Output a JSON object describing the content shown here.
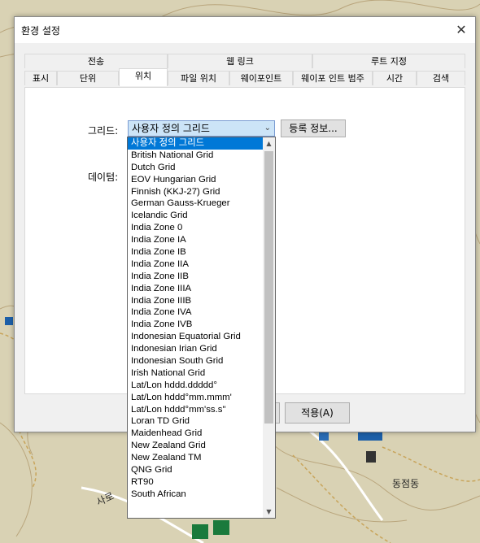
{
  "dialog": {
    "title": "환경 설정",
    "close_label": "✕"
  },
  "tab_groups": [
    {
      "label": "전송"
    },
    {
      "label": "웹 링크"
    },
    {
      "label": "루트 지정"
    }
  ],
  "tabs": [
    {
      "label": "표시"
    },
    {
      "label": "단위"
    },
    {
      "label": "위치",
      "active": true
    },
    {
      "label": "파일 위치"
    },
    {
      "label": "웨이포인트"
    },
    {
      "label": "웨이포 인트 범주"
    },
    {
      "label": "시간"
    },
    {
      "label": "검색"
    }
  ],
  "position_panel": {
    "grid_label": "그리드:",
    "datum_label": "데이텀:",
    "grid_value": "사용자 정의 그리드",
    "register_button": "등록 정보...",
    "apply_button": "적용(A)"
  },
  "grid_options": [
    "사용자 정의 그리드",
    "British National Grid",
    "Dutch Grid",
    "EOV Hungarian Grid",
    "Finnish (KKJ-27) Grid",
    "German Gauss-Krueger",
    "Icelandic Grid",
    "India Zone 0",
    "India Zone IA",
    "India Zone IB",
    "India Zone IIA",
    "India Zone IIB",
    "India Zone IIIA",
    "India Zone IIIB",
    "India Zone IVA",
    "India Zone IVB",
    "Indonesian Equatorial Grid",
    "Indonesian Irian Grid",
    "Indonesian South Grid",
    "Irish National Grid",
    "Lat/Lon hddd.ddddd°",
    "Lat/Lon hddd°mm.mmm'",
    "Lat/Lon hddd°mm'ss.s\"",
    "Loran TD Grid",
    "Maidenhead Grid",
    "New Zealand Grid",
    "New Zealand TM",
    "QNG Grid",
    "RT90",
    "South African"
  ],
  "map": {
    "place_label": "동점동",
    "road_label": "사로"
  }
}
